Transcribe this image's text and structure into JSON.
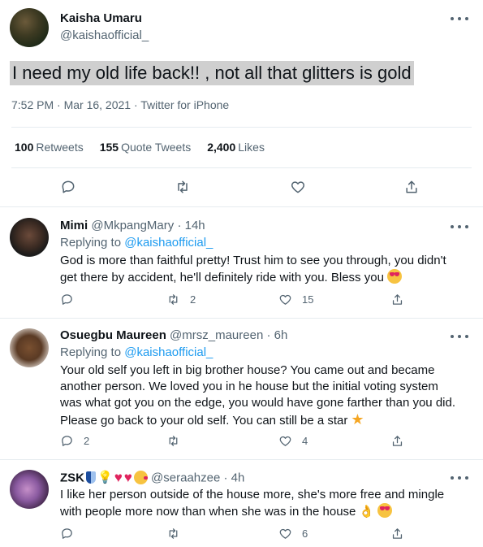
{
  "main_tweet": {
    "author_name": "Kaisha Umaru",
    "author_handle": "@kaishaofficial_",
    "text": "I need my old life back!! , not all that glitters is gold",
    "meta": "7:52 PM · Mar 16, 2021 · Twitter for iPhone",
    "stats": {
      "retweets_count": "100",
      "retweets_label": "Retweets",
      "quote_count": "155",
      "quote_label": "Quote Tweets",
      "likes_count": "2,400",
      "likes_label": "Likes"
    }
  },
  "replies": [
    {
      "name": "Mimi",
      "handle": "@MkpangMary",
      "time": "· 14h",
      "replying_prefix": "Replying to",
      "replying_handle": "@kaishaofficial_",
      "text": "God is more than faithful pretty! Trust him to see you through, you didn't get there by accident, he'll definitely ride with you. Bless you",
      "emoji": "smiling-face-with-heart-eyes",
      "replies_count": "",
      "retweets_count": "2",
      "likes_count": "15"
    },
    {
      "name": "Osuegbu Maureen",
      "handle": "@mrsz_maureen",
      "time": "· 6h",
      "replying_prefix": "Replying to",
      "replying_handle": "@kaishaofficial_",
      "text": "Your old self you left in big brother house? You came out and became another person. We loved you in he house but the initial voting system was what got you on the edge, you would have gone farther than you did. Please go back to your old self. You can still be a star",
      "emoji": "star",
      "replies_count": "2",
      "retweets_count": "",
      "likes_count": "4"
    },
    {
      "name": "ZSK",
      "handle": "@seraahzee",
      "time": "· 4h",
      "name_emojis": [
        "shield-icon",
        "lightbulb-icon",
        "heart-icon",
        "heart-icon",
        "kissing-face-icon"
      ],
      "text": "I like her person outside of the house more, she's more free and mingle with people more now than when she was in the house",
      "emoji": "ok-hand, smiling-face-with-heart-eyes",
      "replies_count": "",
      "retweets_count": "",
      "likes_count": "6"
    }
  ],
  "colors": {
    "text": "#0f1419",
    "secondary": "#536471",
    "link": "#1d9bf0",
    "border": "#e6ecf0",
    "highlight": "#cfcfcf"
  }
}
